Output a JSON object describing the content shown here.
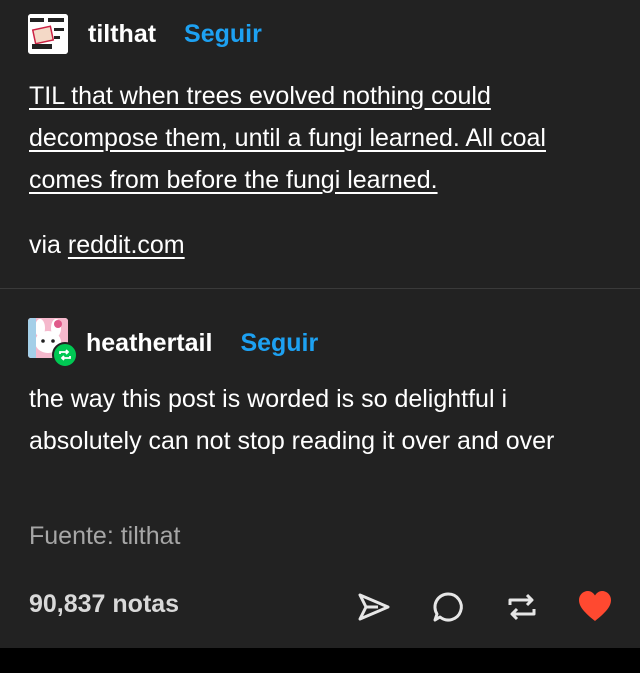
{
  "post": {
    "author": "tilthat",
    "follow_label": "Seguir",
    "body": "TIL that when trees evolved nothing could decompose them, until a fungi learned. All coal comes from before the fungi learned.",
    "via_label": "via",
    "via_link": "reddit.com"
  },
  "reblog": {
    "author": "heathertail",
    "follow_label": "Seguir",
    "body": "the way this post is worded is so delightful i absolutely can not stop reading it over and over",
    "source_label": "Fuente:",
    "source_name": "tilthat"
  },
  "footer": {
    "notes_count": "90,837 notas"
  },
  "icons": {
    "share": "paper-plane-icon",
    "reply": "speech-bubble-icon",
    "reblog": "reblog-icon",
    "like": "heart-icon"
  },
  "colors": {
    "background": "#222222",
    "follow": "#1da1f2",
    "heart": "#ff4930",
    "reblog_badge": "#00c853"
  }
}
